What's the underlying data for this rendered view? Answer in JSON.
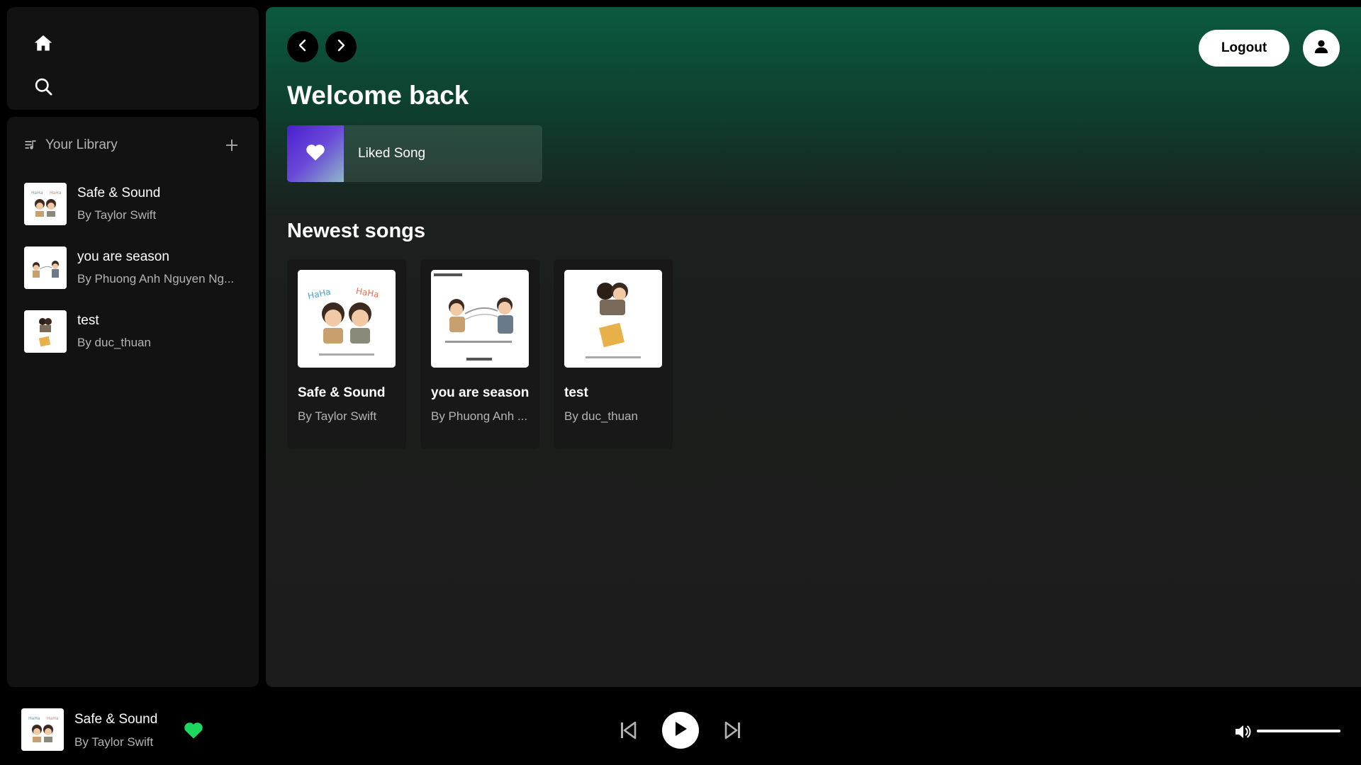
{
  "sidebar": {
    "library_title": "Your Library",
    "items": [
      {
        "title": "Safe & Sound",
        "artist": "By Taylor Swift"
      },
      {
        "title": "you are season",
        "artist": "By Phuong Anh Nguyen Ng..."
      },
      {
        "title": "test",
        "artist": "By duc_thuan"
      }
    ]
  },
  "header": {
    "logout_label": "Logout"
  },
  "main": {
    "welcome": "Welcome back",
    "liked_label": "Liked Song",
    "section_title": "Newest songs",
    "cards": [
      {
        "title": "Safe & Sound",
        "artist": "By Taylor Swift"
      },
      {
        "title": "you are season",
        "artist": "By Phuong Anh ..."
      },
      {
        "title": "test",
        "artist": "By duc_thuan"
      }
    ]
  },
  "player": {
    "title": "Safe & Sound",
    "artist": "By Taylor Swift",
    "volume": 1.0
  },
  "colors": {
    "accent_green": "#1ed760",
    "gradient_top": "#0b5a40",
    "panel_bg": "#121212"
  },
  "icons": [
    "home-icon",
    "search-icon",
    "library-icon",
    "plus-icon",
    "chevron-left-icon",
    "chevron-right-icon",
    "user-icon",
    "heart-icon",
    "skip-back-icon",
    "play-icon",
    "skip-forward-icon",
    "volume-icon"
  ]
}
